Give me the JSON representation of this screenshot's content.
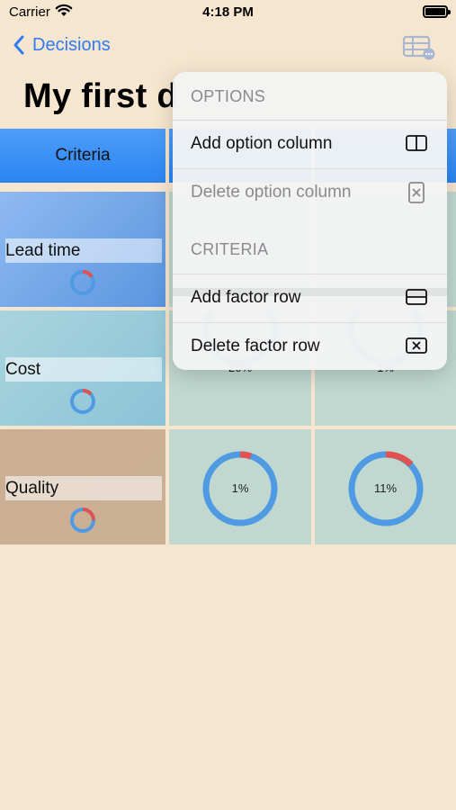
{
  "status_bar": {
    "carrier": "Carrier",
    "time": "4:18 PM"
  },
  "nav": {
    "back_label": "Decisions",
    "table_icon": "table-settings-icon"
  },
  "page": {
    "title": "My first d"
  },
  "grid": {
    "criteria_header": "Criteria",
    "rows": [
      {
        "criterion": "Lead time"
      },
      {
        "criterion": "Cost",
        "scores": [
          "20%",
          "1%"
        ]
      },
      {
        "criterion": "Quality",
        "scores": [
          "1%",
          "11%"
        ]
      }
    ]
  },
  "menu": {
    "options_title": "OPTIONS",
    "add_option_column": "Add option column",
    "delete_option_column": "Delete option column",
    "criteria_title": "CRITERIA",
    "add_factor_row": "Add factor row",
    "delete_factor_row": "Delete factor row"
  },
  "colors": {
    "accent": "#2f7bf5",
    "header_blue": "#3a8ff6",
    "ring_blue": "#4e9be3",
    "ring_red": "#e05252",
    "background": "#f6e6cf"
  }
}
